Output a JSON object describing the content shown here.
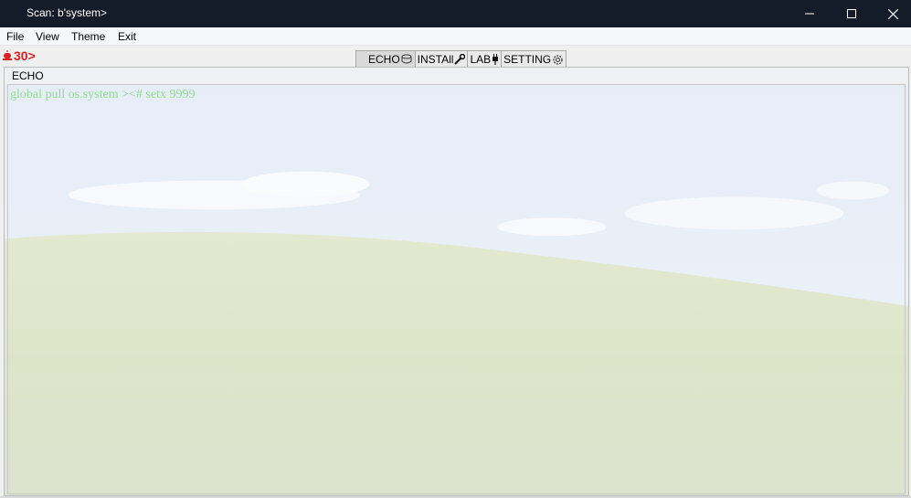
{
  "window": {
    "title": "Scan: b'system>",
    "controls": [
      "minimize-icon",
      "maximize-icon",
      "close-icon"
    ]
  },
  "menu": {
    "items": [
      {
        "label": "File"
      },
      {
        "label": "View"
      },
      {
        "label": "Theme"
      },
      {
        "label": "Exit"
      }
    ]
  },
  "counter": {
    "icon": "alarm-icon",
    "value": "30>",
    "color": "#e02020"
  },
  "tabs": [
    {
      "label": "ECHO",
      "icon": "cup-icon",
      "active": true
    },
    {
      "label": "INSTAll",
      "icon": "wrench-icon",
      "active": false
    },
    {
      "label": "LAB",
      "icon": "plug-icon",
      "active": false
    },
    {
      "label": "SETTING",
      "icon": "gear-icon",
      "active": false
    }
  ],
  "panel": {
    "title": "ECHO",
    "output_line": "global pull os.system ><# setx 9999",
    "output_color": "#8fdc8f"
  }
}
